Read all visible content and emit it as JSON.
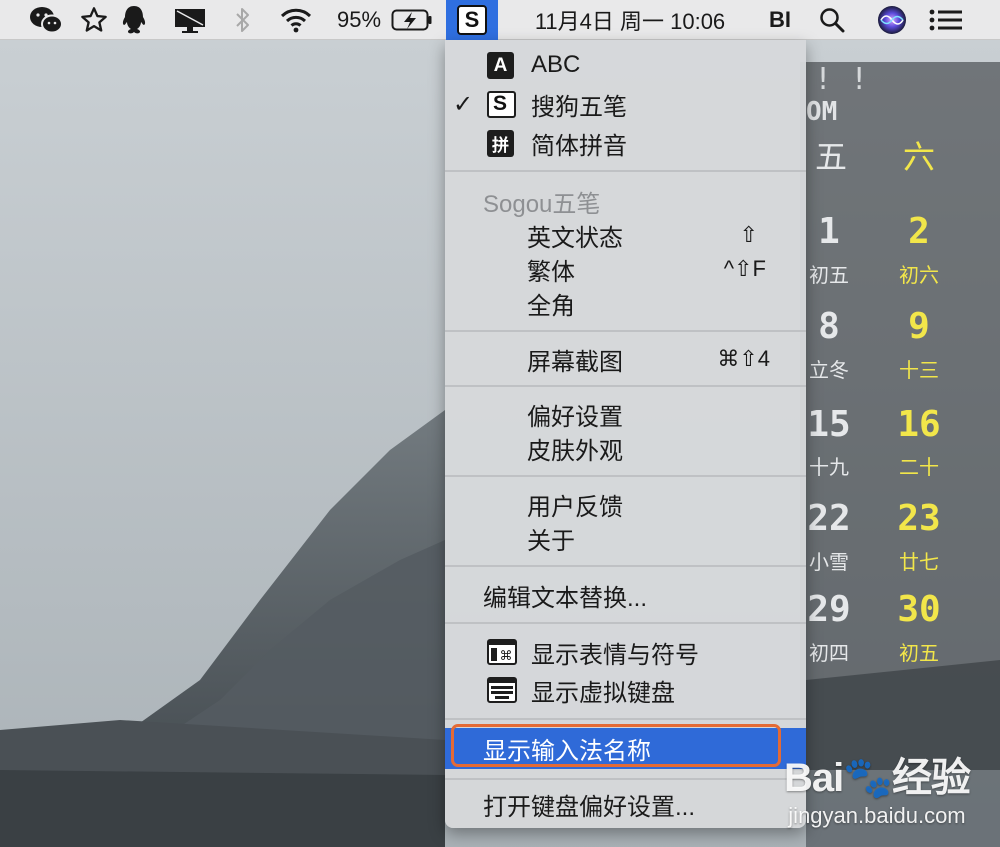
{
  "menubar": {
    "battery_percent": "95%",
    "datetime": "11月4日 周一  10:06",
    "user": "BI",
    "input_icon_letter": "S",
    "icons": [
      "wechat-icon",
      "star-icon",
      "qq-icon",
      "display-icon",
      "bluetooth-icon",
      "wifi-icon",
      "battery-icon",
      "sogou-input-icon",
      "search-icon",
      "siri-icon",
      "list-icon"
    ]
  },
  "menu": {
    "input_sources": [
      {
        "icon": "A",
        "label": "ABC",
        "checked": false
      },
      {
        "icon": "S",
        "label": "搜狗五笔",
        "checked": true
      },
      {
        "icon": "拼",
        "label": "简体拼音",
        "checked": false
      }
    ],
    "check_mark": "✓",
    "section_title": "Sogou五笔",
    "mode_items": [
      {
        "label": "英文状态",
        "shortcut": "⇧"
      },
      {
        "label": "繁体",
        "shortcut": "^⇧F"
      },
      {
        "label": "全角",
        "shortcut": ""
      }
    ],
    "screenshot": {
      "label": "屏幕截图",
      "shortcut": "⌘⇧4"
    },
    "prefs": [
      "偏好设置",
      "皮肤外观"
    ],
    "feedback": [
      "用户反馈",
      "关于"
    ],
    "edit_replace": "编辑文本替换...",
    "show_emoji": "显示表情与符号",
    "show_keyboard": "显示虚拟键盘",
    "show_input_name": "显示输入法名称",
    "open_keyboard_prefs": "打开键盘偏好设置..."
  },
  "calendar": {
    "top_fragment": "! !",
    "month_fragment": "OM",
    "weekdays": [
      "五",
      "六"
    ],
    "rows": [
      [
        {
          "n": "1",
          "s": "初五"
        },
        {
          "n": "2",
          "s": "初六"
        }
      ],
      [
        {
          "n": "8",
          "s": "立冬"
        },
        {
          "n": "9",
          "s": "十三"
        }
      ],
      [
        {
          "n": "15",
          "s": "十九"
        },
        {
          "n": "16",
          "s": "二十"
        }
      ],
      [
        {
          "n": "22",
          "s": "小雪"
        },
        {
          "n": "23",
          "s": "廿七"
        }
      ],
      [
        {
          "n": "29",
          "s": "初四"
        },
        {
          "n": "30",
          "s": "初五"
        }
      ]
    ],
    "colors": {
      "weekday": "#e6e8ea",
      "weekend": "#f2e64a"
    }
  },
  "watermark": {
    "logo": "Bai🐾经验",
    "url": "jingyan.baidu.com"
  },
  "colors": {
    "menubar_bg": "#e9e9ea",
    "menu_bg": "#d6d8db",
    "highlight": "#2f6ad8",
    "ring": "#e46a35"
  }
}
